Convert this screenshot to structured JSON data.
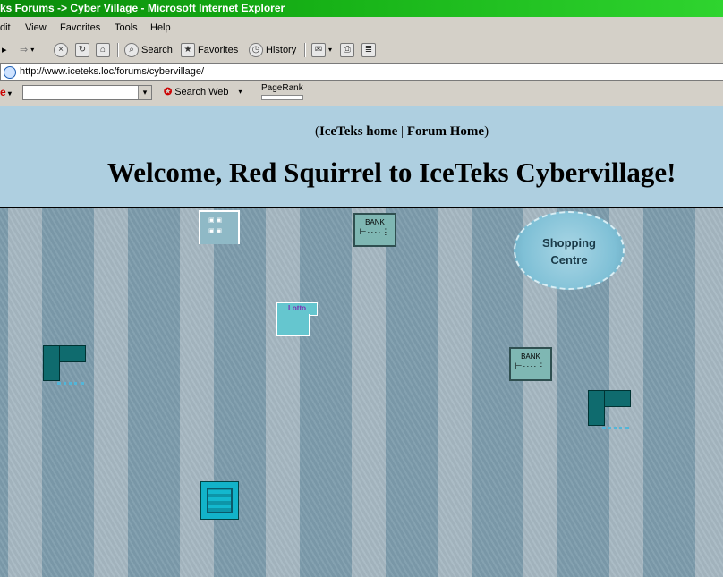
{
  "window": {
    "title": "ks Forums -> Cyber Village - Microsoft Internet Explorer"
  },
  "menu": {
    "items": [
      "dit",
      "View",
      "Favorites",
      "Tools",
      "Help"
    ]
  },
  "toolbar": {
    "search_label": "Search",
    "favorites_label": "Favorites",
    "history_label": "History"
  },
  "address": {
    "url": "http://www.iceteks.loc/forums/cybervillage/"
  },
  "searchbar": {
    "logo_text": "e",
    "search_web_label": "Search Web",
    "pagerank_label": "PageRank",
    "dropdown_arrow": "▾"
  },
  "page": {
    "paren_open": "(",
    "home_link": "IceTeks home",
    "separator": "|",
    "forum_link": "Forum Home",
    "paren_close": ")",
    "welcome": "Welcome, Red Squirrel to IceTeks Cybervillage!"
  },
  "village": {
    "bank1_label": "BANK",
    "bank2_label": "BANK",
    "shop_line1": "Shopping",
    "shop_line2": "Centre",
    "lotto_label": "Lotto"
  },
  "icons": {
    "back": "back-arrow-icon",
    "forward": "forward-arrow-icon",
    "stop": "stop-icon",
    "refresh": "refresh-icon",
    "home": "home-icon",
    "search": "search-icon",
    "favorites": "favorites-icon",
    "history": "history-icon",
    "mail": "mail-icon",
    "print": "print-icon",
    "edit": "edit-icon"
  },
  "colors": {
    "titlebar": "#17b217",
    "header_bg": "#aecfe0",
    "stripe_dark": "#7d9cac",
    "stripe_light": "#a6b8c2"
  }
}
